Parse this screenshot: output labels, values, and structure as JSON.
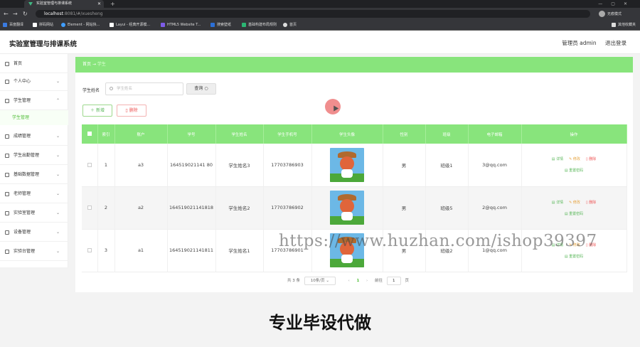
{
  "browser": {
    "tab_title": "实验室管理与排课系统",
    "url_host": "localhost",
    "url_path": ":8081/#/xuesheng",
    "incognito": "无痕模式",
    "bookmarks": [
      "百度翻译",
      "拼码网站",
      "Element - 网站快...",
      "Layui - 经典开源模...",
      "HTML5 Website T...",
      "搜索壁纸",
      "基础构建布局规则",
      "首页"
    ],
    "bookmarks_right": "其他收藏夹"
  },
  "app": {
    "title": "实验室管理与排课系统",
    "user": "管理员 admin",
    "logout": "退出登录"
  },
  "sidebar": {
    "items": [
      {
        "label": "首页",
        "icon": "home-icon"
      },
      {
        "label": "个人中心",
        "icon": "user-icon"
      },
      {
        "label": "学生管理",
        "icon": "user-group-icon"
      },
      {
        "label": "成绩管理",
        "icon": "document-icon"
      },
      {
        "label": "学生出勤管理",
        "icon": "user-icon"
      },
      {
        "label": "基础数据管理",
        "icon": "database-icon"
      },
      {
        "label": "老师管理",
        "icon": "teacher-icon"
      },
      {
        "label": "实验室管理",
        "icon": "lab-icon"
      },
      {
        "label": "设备管理",
        "icon": "device-icon"
      },
      {
        "label": "实验台管理",
        "icon": "bench-icon"
      }
    ],
    "active_sub": "学生管理"
  },
  "breadcrumb": {
    "home": "首页",
    "sep": "→",
    "current": "学生"
  },
  "search": {
    "label": "学生姓名",
    "placeholder": "学生姓名",
    "button": "查询"
  },
  "actions": {
    "add": "新增",
    "delete": "删除"
  },
  "table": {
    "headers": [
      "索引",
      "账户",
      "学号",
      "学生姓名",
      "学生手机号",
      "学生头像",
      "性别",
      "班级",
      "电子邮箱",
      "操作"
    ],
    "rows": [
      {
        "index": "1",
        "account": "a3",
        "no": "164519021141 80",
        "name": "学生姓名3",
        "phone": "17703786903",
        "gender": "男",
        "class": "班级1",
        "email": "3@qq.com"
      },
      {
        "index": "2",
        "account": "a2",
        "no": "164519021141818",
        "name": "学生姓名2",
        "phone": "17703786902",
        "gender": "男",
        "class": "班级5",
        "email": "2@qq.com"
      },
      {
        "index": "3",
        "account": "a1",
        "no": "164519021141811",
        "name": "学生姓名1",
        "phone": "17703786901",
        "gender": "男",
        "class": "班级2",
        "email": "1@qq.com"
      }
    ],
    "ops": {
      "detail": "详情",
      "edit": "修改",
      "del": "删除",
      "reset": "重置密码"
    }
  },
  "pager": {
    "total": "共 3 条",
    "size": "10条/页",
    "page": "1",
    "goto_label": "前往",
    "goto_value": "1",
    "goto_unit": "页"
  },
  "watermark": "https://www.huzhan.com/ishop39397",
  "banner": "专业毕设代做"
}
